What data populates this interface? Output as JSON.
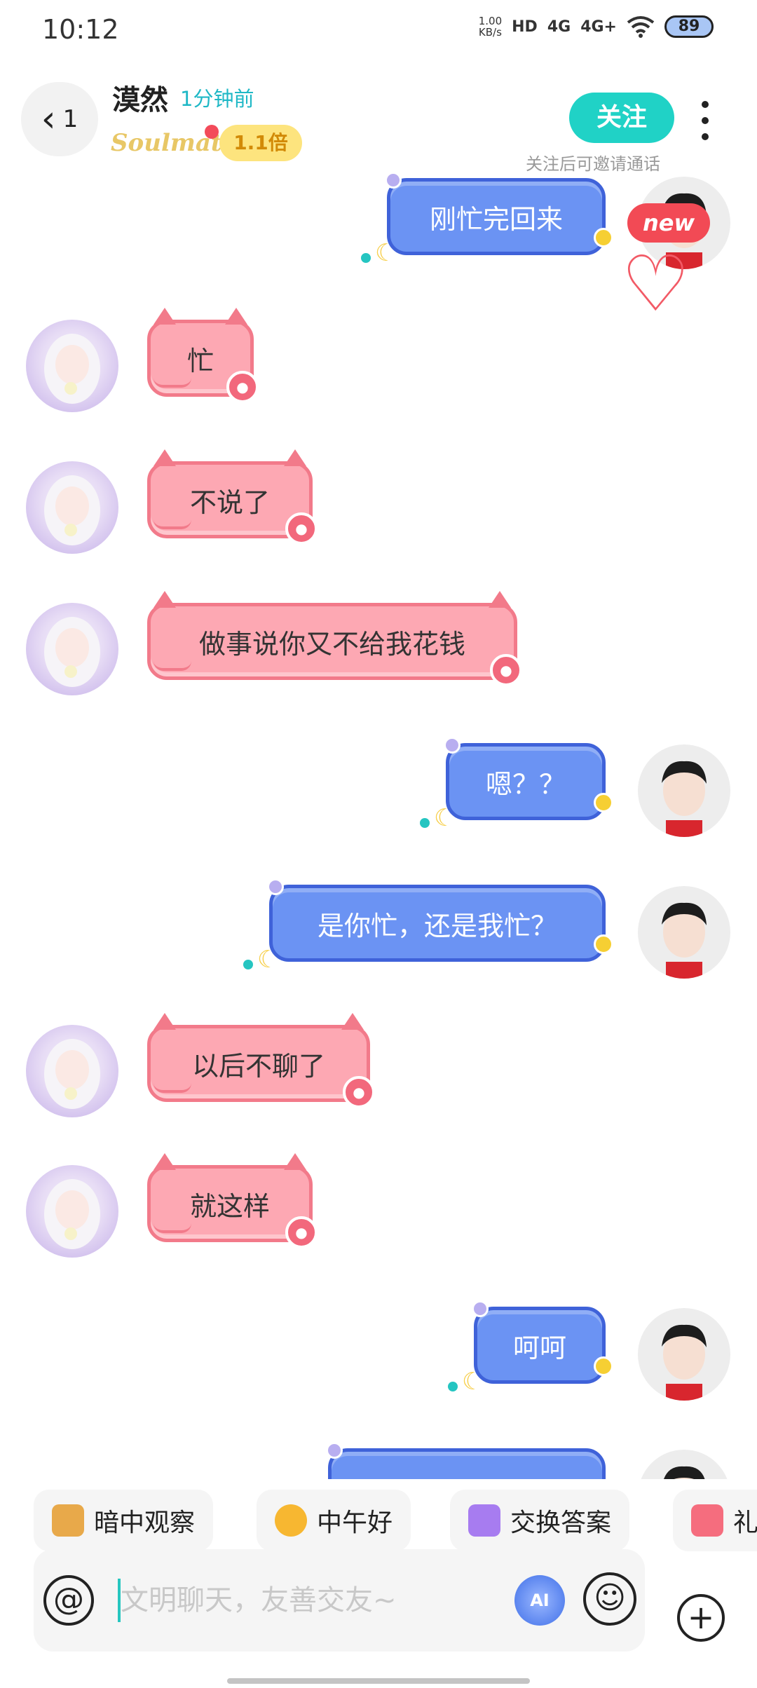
{
  "status_bar": {
    "time": "10:12",
    "net_speed_value": "1.00",
    "net_speed_unit": "KB/s",
    "hd_label": "HD",
    "signal1": "4G",
    "signal2": "4G+",
    "battery": "89"
  },
  "header": {
    "back_count": "1",
    "contact_name": "漠然",
    "last_seen": "1分钟前",
    "soulmate_logo": "Soulmate",
    "multiplier": "1.1倍",
    "follow_label": "关注",
    "follow_hint": "关注后可邀请通话"
  },
  "messages": [
    {
      "side": "me",
      "text": "刚忙完回来"
    },
    {
      "side": "other",
      "text": "忙"
    },
    {
      "side": "other",
      "text": "不说了"
    },
    {
      "side": "other",
      "text": "做事说你又不给我花钱"
    },
    {
      "side": "me",
      "text": "嗯？？"
    },
    {
      "side": "me",
      "text": "是你忙，还是我忙？"
    },
    {
      "side": "other",
      "text": "以后不聊了"
    },
    {
      "side": "other",
      "text": "就这样"
    },
    {
      "side": "me",
      "text": "呵呵"
    }
  ],
  "new_badge": "new",
  "quick_replies": [
    {
      "label": "暗中观察",
      "icon": "doge-peek-icon",
      "color": "#e8a94a"
    },
    {
      "label": "中午好",
      "icon": "sun-sunglasses-icon",
      "color": "#f7b731"
    },
    {
      "label": "交换答案",
      "icon": "exchange-icon",
      "color": "#a77cf0"
    },
    {
      "label": "礼",
      "icon": "gift-icon",
      "color": "#f56d7e"
    }
  ],
  "input": {
    "placeholder": "文明聊天，友善交友~",
    "at_symbol": "@",
    "ai_label": "AI",
    "emoji_symbol": "☺",
    "plus_symbol": "+"
  },
  "colors": {
    "accent_teal": "#20d2c6",
    "bubble_me": "#6b93f3",
    "bubble_other": "#fda8b3",
    "badge_red": "#f24a55"
  }
}
